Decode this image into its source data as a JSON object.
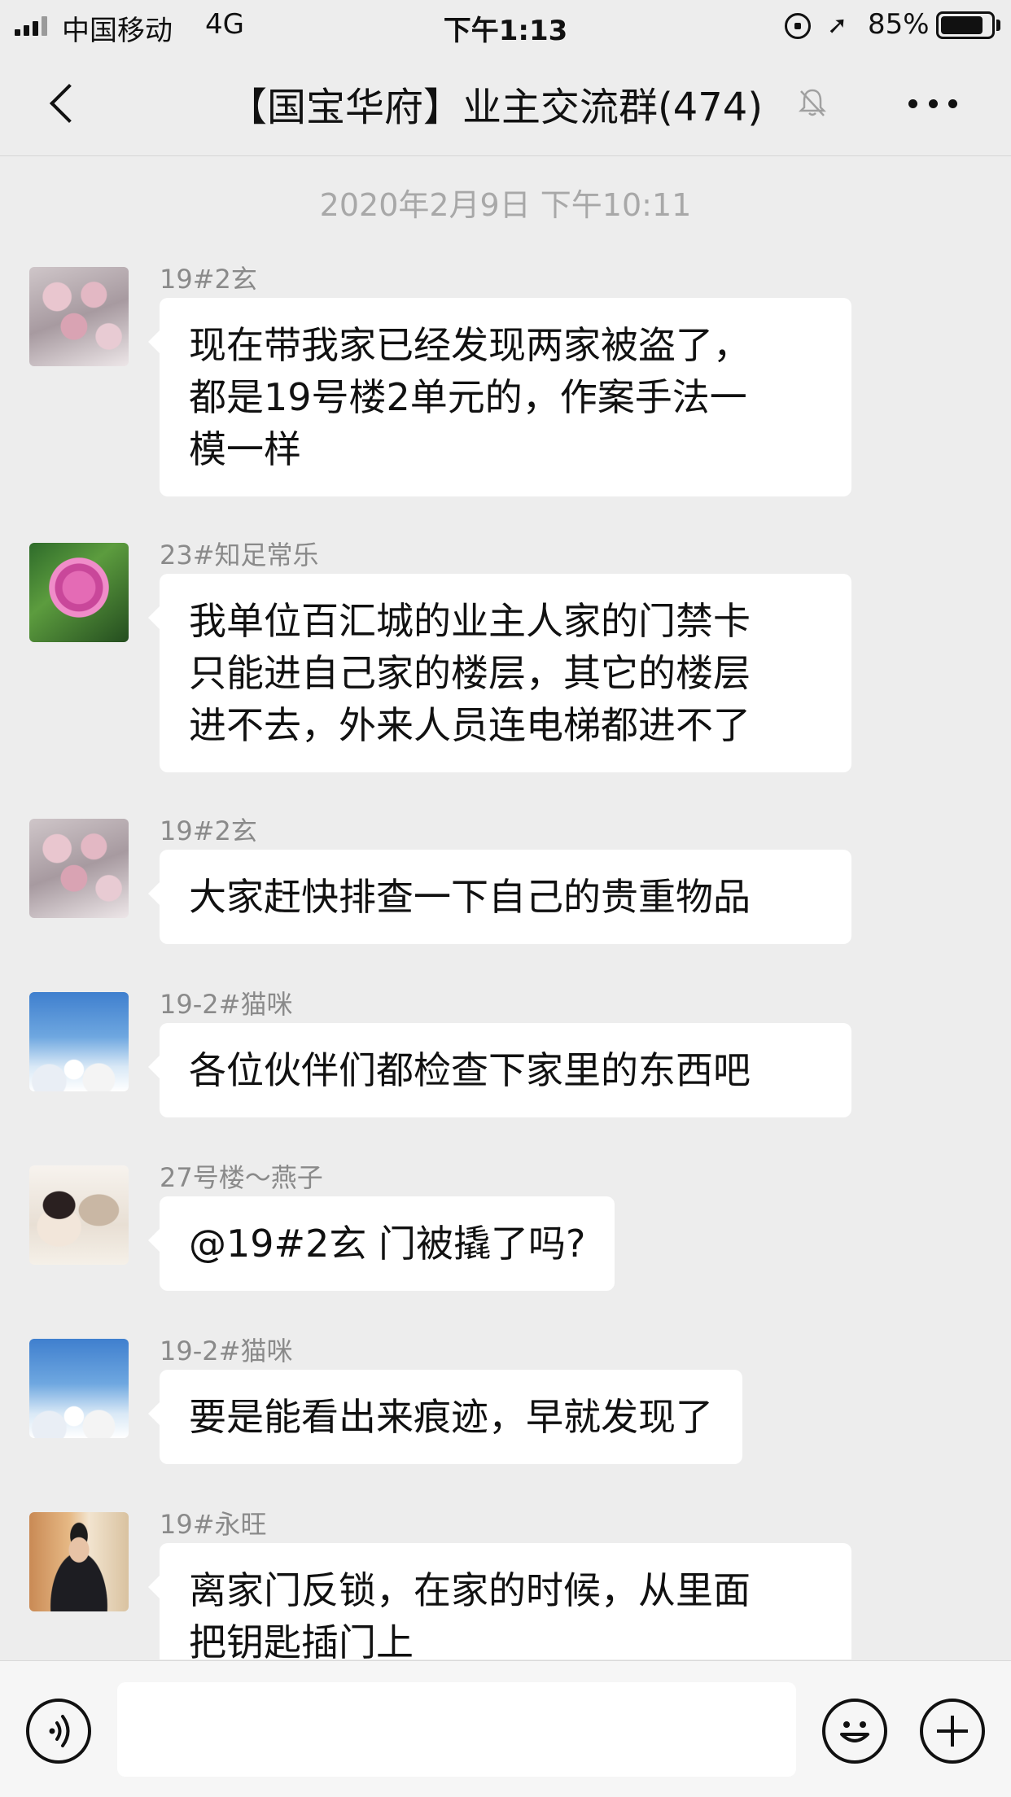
{
  "status_bar": {
    "carrier": "中国移动",
    "network": "4G",
    "time": "下午1:13",
    "battery_percent": "85%",
    "battery_level": 0.85
  },
  "header": {
    "title": "【国宝华府】业主交流群(474)",
    "icons": [
      "back-icon",
      "mute-bell-icon",
      "more-icon"
    ]
  },
  "chat": {
    "timestamp": "2020年2月9日 下午10:11",
    "messages": [
      {
        "sender": "19#2玄",
        "text": "现在带我家已经发现两家被盗了，\n都是19号楼2单元的，作案手法一\n模一样"
      },
      {
        "sender": "23#知足常乐",
        "text": "我单位百汇城的业主人家的门禁卡\n只能进自己家的楼层，其它的楼层\n进不去，外来人员连电梯都进不了"
      },
      {
        "sender": "19#2玄",
        "text": "大家赶快排查一下自己的贵重物品"
      },
      {
        "sender": "19-2#猫咪",
        "text": "各位伙伴们都检查下家里的东西吧"
      },
      {
        "sender": "27号楼～燕子",
        "text": "@19#2玄 门被撬了吗?"
      },
      {
        "sender": "19-2#猫咪",
        "text": "要是能看出来痕迹，早就发现了"
      },
      {
        "sender": "19#永旺",
        "text": "离家门反锁，在家的时候，从里面\n把钥匙插门上"
      }
    ]
  },
  "input_bar": {
    "icons": [
      "voice-icon",
      "emoji-icon",
      "plus-icon"
    ]
  }
}
